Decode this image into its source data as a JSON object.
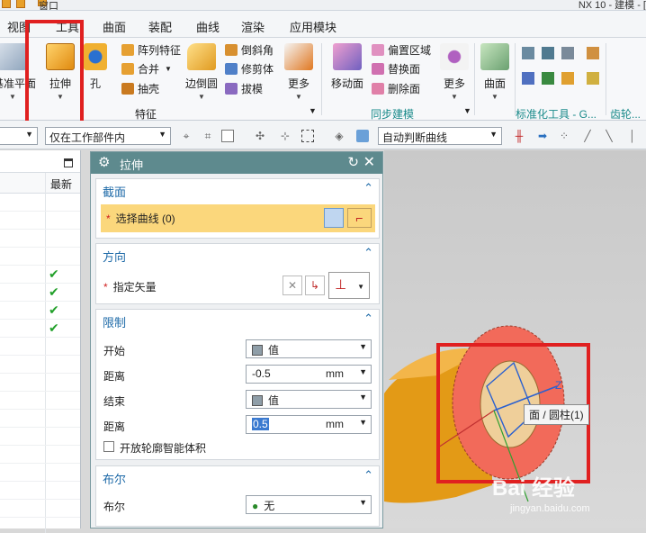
{
  "title_bar": {
    "window_menu": "窗口",
    "app_title": "NX 10 - 建模 - ["
  },
  "menu_tabs": [
    "视图",
    "工具",
    "曲面",
    "装配",
    "曲线",
    "渲染",
    "应用模块"
  ],
  "ribbon": {
    "sketch_label": "基准平面",
    "extrude_label": "拉伸",
    "hole_label": "孔",
    "small_feature": [
      "阵列特征",
      "合并",
      "抽壳"
    ],
    "edge_blend_label": "边倒圆",
    "small_detail": [
      "倒斜角",
      "修剪体",
      "拔模"
    ],
    "more_label": "更多",
    "feature_group": "特征",
    "move_face_label": "移动面",
    "small_sync": [
      "偏置区域",
      "替换面",
      "删除面"
    ],
    "more2_label": "更多",
    "sync_group": "同步建模",
    "surface_label": "曲面",
    "std_group": "标准化工具 - G...",
    "gear_group": "齿轮..."
  },
  "filter_bar": {
    "scope_value": "仅在工作部件内",
    "curve_rule_value": "自动判断曲线"
  },
  "navigator": {
    "column_header": "最新",
    "checked_rows": 4
  },
  "dialog": {
    "title": "拉伸",
    "section_label": "截面",
    "select_curve": "选择曲线 (0)",
    "direction_label": "方向",
    "specify_vector": "指定矢量",
    "limits_label": "限制",
    "start_label": "开始",
    "start_value": "值",
    "distance1_label": "距离",
    "distance1_value": "-0.5",
    "distance1_unit": "mm",
    "end_label": "结束",
    "end_value": "值",
    "distance2_label": "距离",
    "distance2_value": "0.5",
    "distance2_unit": "mm",
    "open_profile_label": "开放轮廓智能体积",
    "boolean_section": "布尔",
    "boolean_label": "布尔",
    "boolean_value": "无"
  },
  "viewport": {
    "face_tooltip": "面 / 圆柱(1)",
    "axis_z": "Z",
    "watermark": "Bai 经验",
    "watermark_url": "jingyan.baidu.com"
  },
  "colors": {
    "dialog_title_bg": "#5e8a8e",
    "required_field": "#fbd77c",
    "highlight_red": "#e02020",
    "part_orange": "#f0a21a",
    "selected_face": "#f26a5a"
  }
}
